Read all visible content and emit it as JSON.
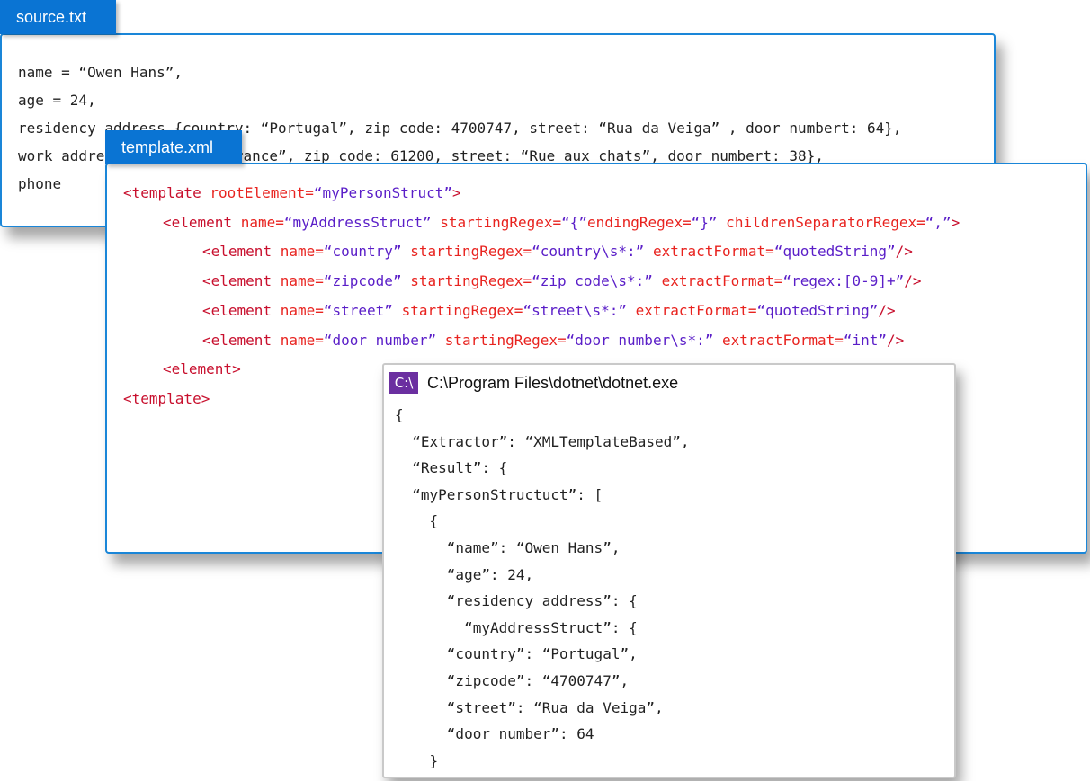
{
  "source": {
    "tab": "source.txt",
    "lines": [
      "name = “Owen Hans”,",
      "age = 24,",
      "residency address {country: “Portugal”, zip code: 4700747, street: “Rua da Veiga” , door numbert: 64},",
      "work address {country: “France”, zip code: 61200, street: “Rue aux chats”, door numbert: 38},",
      "phone"
    ]
  },
  "template": {
    "tab": "template.xml",
    "lines": [
      [
        [
          "tag",
          "<template "
        ],
        [
          "attr",
          "rootElement="
        ],
        [
          "val",
          "“myPersonStruct”"
        ],
        [
          "tag",
          ">"
        ]
      ],
      [
        [
          "tag",
          "<element "
        ],
        [
          "attr",
          "name="
        ],
        [
          "val",
          "“myAddressStruct”"
        ],
        [
          "attr",
          " startingRegex="
        ],
        [
          "val",
          "“{”"
        ],
        [
          "attr",
          "endingRegex="
        ],
        [
          "val",
          "“}”"
        ],
        [
          "attr",
          " childrenSeparatorRegex="
        ],
        [
          "val",
          "“,”"
        ],
        [
          "tag",
          ">"
        ]
      ],
      [
        [
          "tag",
          "<element "
        ],
        [
          "attr",
          "name="
        ],
        [
          "val",
          "“country”"
        ],
        [
          "attr",
          " startingRegex="
        ],
        [
          "val",
          "“country\\s*:”"
        ],
        [
          "attr",
          " extractFormat="
        ],
        [
          "val",
          "“quotedString”"
        ],
        [
          "tag",
          "/>"
        ]
      ],
      [
        [
          "tag",
          "<element "
        ],
        [
          "attr",
          "name="
        ],
        [
          "val",
          "“zipcode”"
        ],
        [
          "attr",
          " startingRegex="
        ],
        [
          "val",
          "“zip code\\s*:”"
        ],
        [
          "attr",
          " extractFormat="
        ],
        [
          "val",
          "“regex:[0-9]+”"
        ],
        [
          "tag",
          "/>"
        ]
      ],
      [
        [
          "tag",
          "<element "
        ],
        [
          "attr",
          "name="
        ],
        [
          "val",
          "“street”"
        ],
        [
          "attr",
          " startingRegex="
        ],
        [
          "val",
          "“street\\s*:”"
        ],
        [
          "attr",
          " extractFormat="
        ],
        [
          "val",
          "“quotedString”"
        ],
        [
          "tag",
          "/>"
        ]
      ],
      [
        [
          "tag",
          "<element "
        ],
        [
          "attr",
          "name="
        ],
        [
          "val",
          "“door number”"
        ],
        [
          "attr",
          " startingRegex="
        ],
        [
          "val",
          "“door number\\s*:”"
        ],
        [
          "attr",
          " extractFormat="
        ],
        [
          "val",
          "“int”"
        ],
        [
          "tag",
          "/>"
        ]
      ],
      [
        [
          "tag",
          "<element>"
        ]
      ],
      [
        [
          "tag",
          "<template>"
        ]
      ]
    ]
  },
  "terminal": {
    "icon": "C:\\",
    "title": "C:\\Program Files\\dotnet\\dotnet.exe",
    "lines": [
      "{",
      "  “Extractor”: “XMLTemplateBased”,",
      "  “Result”: {",
      "  “myPersonStructuct”: [",
      "    {",
      "      “name”: “Owen Hans”,",
      "      “age”: 24,",
      "      “residency address”: {",
      "        “myAddressStruct”: {",
      "      “country”: “Portugal”,",
      "      “zipcode”: “4700747”,",
      "      “street”: “Rua da Veiga”,",
      "      “door number”: 64",
      "    }"
    ]
  },
  "colors": {
    "tab_blue": "#0a74d3",
    "frame_blue": "#1a86d8",
    "tag": "#c8102e",
    "attr": "#e8231f",
    "value": "#5a1ec8",
    "term_icon": "#6b2fa0"
  }
}
